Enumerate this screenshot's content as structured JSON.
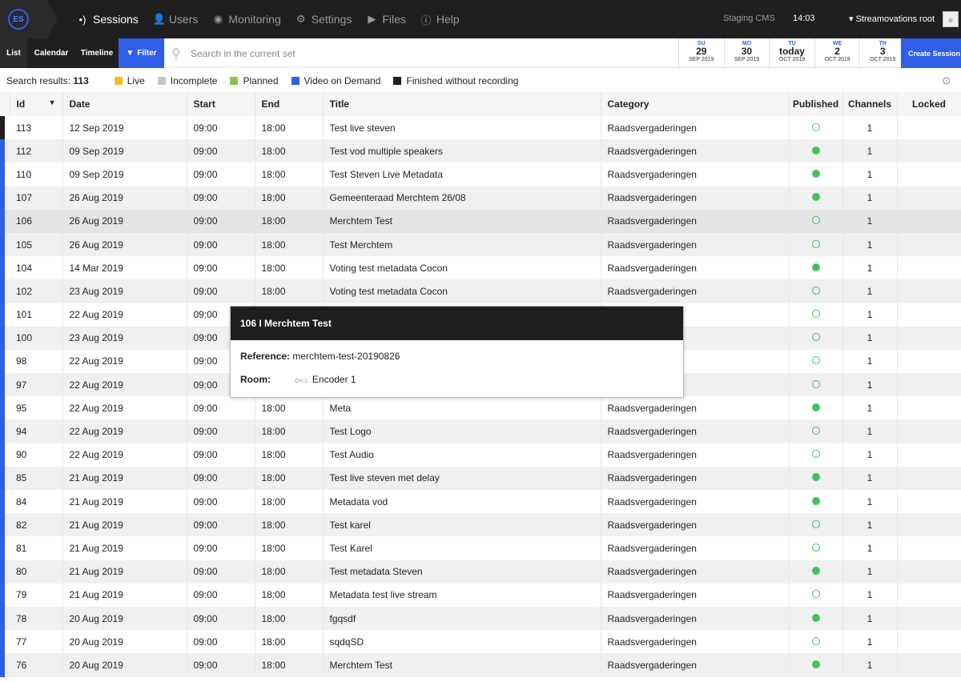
{
  "app": {
    "logo": "ES",
    "staging": "Staging CMS",
    "time": "14:03",
    "user": "Streamovations root"
  },
  "nav": [
    {
      "label": "Sessions",
      "icon": "broadcast-icon",
      "glyph": "•)",
      "active": true
    },
    {
      "label": "Users",
      "icon": "user-icon",
      "glyph": "👤"
    },
    {
      "label": "Monitoring",
      "icon": "eye-icon",
      "glyph": "◉"
    },
    {
      "label": "Settings",
      "icon": "gear-icon",
      "glyph": "⚙"
    },
    {
      "label": "Files",
      "icon": "folder-icon",
      "glyph": "▶"
    },
    {
      "label": "Help",
      "icon": "info-icon",
      "glyph": "ⓘ"
    }
  ],
  "views": {
    "list": "List",
    "calendar": "Calendar",
    "timeline": "Timeline",
    "filter": "Filter"
  },
  "search": {
    "placeholder": "Search in the current set"
  },
  "days": [
    {
      "dow": "SU",
      "day": "29",
      "month": "SEP 2019"
    },
    {
      "dow": "MO",
      "day": "30",
      "month": "SEP 2019"
    },
    {
      "dow": "TU",
      "day": "today",
      "month": "OCT 2019"
    },
    {
      "dow": "WE",
      "day": "2",
      "month": "OCT 2019"
    },
    {
      "dow": "TH",
      "day": "3",
      "month": "OCT 2019"
    }
  ],
  "create_label": "Create Session",
  "results": {
    "label": "Search results:",
    "count": "113"
  },
  "legend": [
    {
      "label": "Live",
      "color": "#f7b924"
    },
    {
      "label": "Incomplete",
      "color": "#c4c4c4"
    },
    {
      "label": "Planned",
      "color": "#8bc34a"
    },
    {
      "label": "Video on Demand",
      "color": "#2f5ee8"
    },
    {
      "label": "Finished without recording",
      "color": "#1f1f1f"
    }
  ],
  "columns": [
    "Id",
    "Date",
    "Start",
    "End",
    "Title",
    "Category",
    "Published",
    "Channels",
    "Locked"
  ],
  "rows": [
    {
      "id": "113",
      "date": "12 Sep 2019",
      "start": "09:00",
      "end": "18:00",
      "title": "Test live steven",
      "category": "Raadsvergaderingen",
      "published": false,
      "channels": "1",
      "status": "#1f1f1f"
    },
    {
      "id": "112",
      "date": "09 Sep 2019",
      "start": "09:00",
      "end": "18:00",
      "title": "Test vod multiple speakers",
      "category": "Raadsvergaderingen",
      "published": true,
      "channels": "1",
      "status": "#2f5ee8"
    },
    {
      "id": "110",
      "date": "09 Sep 2019",
      "start": "09:00",
      "end": "18:00",
      "title": "Test Steven Live Metadata",
      "category": "Raadsvergaderingen",
      "published": true,
      "channels": "1",
      "status": "#2f5ee8"
    },
    {
      "id": "107",
      "date": "26 Aug 2019",
      "start": "09:00",
      "end": "18:00",
      "title": "Gemeenteraad Merchtem 26/08",
      "category": "Raadsvergaderingen",
      "published": true,
      "channels": "1",
      "status": "#2f5ee8"
    },
    {
      "id": "106",
      "date": "26 Aug 2019",
      "start": "09:00",
      "end": "18:00",
      "title": "Merchtem Test",
      "category": "Raadsvergaderingen",
      "published": false,
      "channels": "1",
      "status": "#2f5ee8",
      "hover": true
    },
    {
      "id": "105",
      "date": "26 Aug 2019",
      "start": "09:00",
      "end": "18:00",
      "title": "Test Merchtem",
      "category": "Raadsvergaderingen",
      "published": false,
      "channels": "1",
      "status": "#2f5ee8"
    },
    {
      "id": "104",
      "date": "14 Mar 2019",
      "start": "09:00",
      "end": "18:00",
      "title": "Voting test metadata Cocon",
      "category": "Raadsvergaderingen",
      "published": true,
      "channels": "1",
      "status": "#2f5ee8"
    },
    {
      "id": "102",
      "date": "23 Aug 2019",
      "start": "09:00",
      "end": "18:00",
      "title": "Voting test metadata Cocon",
      "category": "Raadsvergaderingen",
      "published": false,
      "channels": "1",
      "status": "#2f5ee8"
    },
    {
      "id": "101",
      "date": "22 Aug 2019",
      "start": "09:00",
      "end": "",
      "title": "",
      "category": "en",
      "published": false,
      "channels": "1",
      "status": "#2f5ee8"
    },
    {
      "id": "100",
      "date": "23 Aug 2019",
      "start": "09:00",
      "end": "",
      "title": "",
      "category": "en",
      "published": false,
      "channels": "1",
      "status": "#2f5ee8"
    },
    {
      "id": "98",
      "date": "22 Aug 2019",
      "start": "09:00",
      "end": "",
      "title": "",
      "category": "en",
      "published": false,
      "channels": "1",
      "status": "#2f5ee8"
    },
    {
      "id": "97",
      "date": "22 Aug 2019",
      "start": "09:00",
      "end": "",
      "title": "",
      "category": "en",
      "published": false,
      "channels": "1",
      "status": "#2f5ee8"
    },
    {
      "id": "95",
      "date": "22 Aug 2019",
      "start": "09:00",
      "end": "18:00",
      "title": "Meta",
      "category": "Raadsvergaderingen",
      "published": true,
      "channels": "1",
      "status": "#2f5ee8"
    },
    {
      "id": "94",
      "date": "22 Aug 2019",
      "start": "09:00",
      "end": "18:00",
      "title": "Test Logo",
      "category": "Raadsvergaderingen",
      "published": false,
      "channels": "1",
      "status": "#2f5ee8"
    },
    {
      "id": "90",
      "date": "22 Aug 2019",
      "start": "09:00",
      "end": "18:00",
      "title": "Test Audio",
      "category": "Raadsvergaderingen",
      "published": false,
      "channels": "1",
      "status": "#2f5ee8"
    },
    {
      "id": "85",
      "date": "21 Aug 2019",
      "start": "09:00",
      "end": "18:00",
      "title": "Test live steven met delay",
      "category": "Raadsvergaderingen",
      "published": true,
      "channels": "1",
      "status": "#2f5ee8"
    },
    {
      "id": "84",
      "date": "21 Aug 2019",
      "start": "09:00",
      "end": "18:00",
      "title": "Metadata vod",
      "category": "Raadsvergaderingen",
      "published": true,
      "channels": "1",
      "status": "#2f5ee8"
    },
    {
      "id": "82",
      "date": "21 Aug 2019",
      "start": "09:00",
      "end": "18:00",
      "title": "Test karel",
      "category": "Raadsvergaderingen",
      "published": false,
      "channels": "1",
      "status": "#2f5ee8"
    },
    {
      "id": "81",
      "date": "21 Aug 2019",
      "start": "09:00",
      "end": "18:00",
      "title": "Test Karel",
      "category": "Raadsvergaderingen",
      "published": false,
      "channels": "1",
      "status": "#2f5ee8"
    },
    {
      "id": "80",
      "date": "21 Aug 2019",
      "start": "09:00",
      "end": "18:00",
      "title": "Test metadata Steven",
      "category": "Raadsvergaderingen",
      "published": true,
      "channels": "1",
      "status": "#2f5ee8"
    },
    {
      "id": "79",
      "date": "21 Aug 2019",
      "start": "09:00",
      "end": "18:00",
      "title": "Metadata test live stream",
      "category": "Raadsvergaderingen",
      "published": false,
      "channels": "1",
      "status": "#2f5ee8"
    },
    {
      "id": "78",
      "date": "20 Aug 2019",
      "start": "09:00",
      "end": "18:00",
      "title": "fgqsdf",
      "category": "Raadsvergaderingen",
      "published": true,
      "channels": "1",
      "status": "#2f5ee8"
    },
    {
      "id": "77",
      "date": "20 Aug 2019",
      "start": "09:00",
      "end": "18:00",
      "title": "sqdqSD",
      "category": "Raadsvergaderingen",
      "published": false,
      "channels": "1",
      "status": "#2f5ee8"
    },
    {
      "id": "76",
      "date": "20 Aug 2019",
      "start": "09:00",
      "end": "18:00",
      "title": "Merchtem Test",
      "category": "Raadsvergaderingen",
      "published": true,
      "channels": "1",
      "status": "#2f5ee8"
    }
  ],
  "popover": {
    "title": "106 I Merchtem Test",
    "reference_label": "Reference:",
    "reference": "merchtem-test-20190826",
    "room_label": "Room:",
    "channel": "CH 1:",
    "room": "Encoder 1"
  }
}
